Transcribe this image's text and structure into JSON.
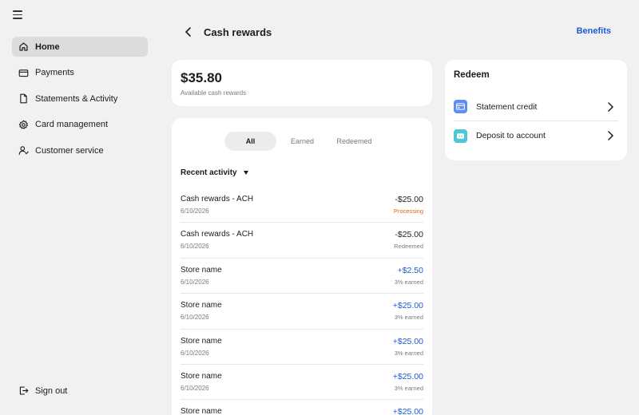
{
  "sidebar": {
    "items": [
      {
        "label": "Home",
        "icon": "home-icon"
      },
      {
        "label": "Payments",
        "icon": "card-icon"
      },
      {
        "label": "Statements & Activity",
        "icon": "document-icon"
      },
      {
        "label": "Card management",
        "icon": "gear-icon"
      },
      {
        "label": "Customer service",
        "icon": "person-icon"
      }
    ],
    "signout": {
      "label": "Sign out",
      "icon": "sign-out-icon"
    }
  },
  "header": {
    "title": "Cash rewards",
    "benefits_label": "Benefits"
  },
  "balance": {
    "amount": "$35.80",
    "label": "Available cash rewards"
  },
  "tabs": [
    "All",
    "Earned",
    "Redeemed"
  ],
  "activity": {
    "filter_label": "Recent activity",
    "transactions": [
      {
        "name": "Cash rewards - ACH",
        "date": "6/10/2026",
        "amount": "-$25.00",
        "status": "Processing"
      },
      {
        "name": "Cash rewards - ACH",
        "date": "6/10/2026",
        "amount": "-$25.00",
        "status": "Redeemed"
      },
      {
        "name": "Store name",
        "date": "6/10/2026",
        "amount": "+$2.50",
        "status": "3% earned"
      },
      {
        "name": "Store name",
        "date": "6/10/2026",
        "amount": "+$25.00",
        "status": "3% earned"
      },
      {
        "name": "Store name",
        "date": "6/10/2026",
        "amount": "+$25.00",
        "status": "3% earned"
      },
      {
        "name": "Store name",
        "date": "6/10/2026",
        "amount": "+$25.00",
        "status": "3% earned"
      },
      {
        "name": "Store name",
        "date": "",
        "amount": "+$25.00",
        "status": ""
      }
    ]
  },
  "redeem": {
    "title": "Redeem",
    "options": [
      {
        "label": "Statement credit",
        "icon": "statement-credit-icon"
      },
      {
        "label": "Deposit to account",
        "icon": "deposit-icon"
      }
    ]
  },
  "colors": {
    "accent": "#1a5bd6",
    "processing": "#e0601a",
    "background": "#f1f1f3"
  }
}
